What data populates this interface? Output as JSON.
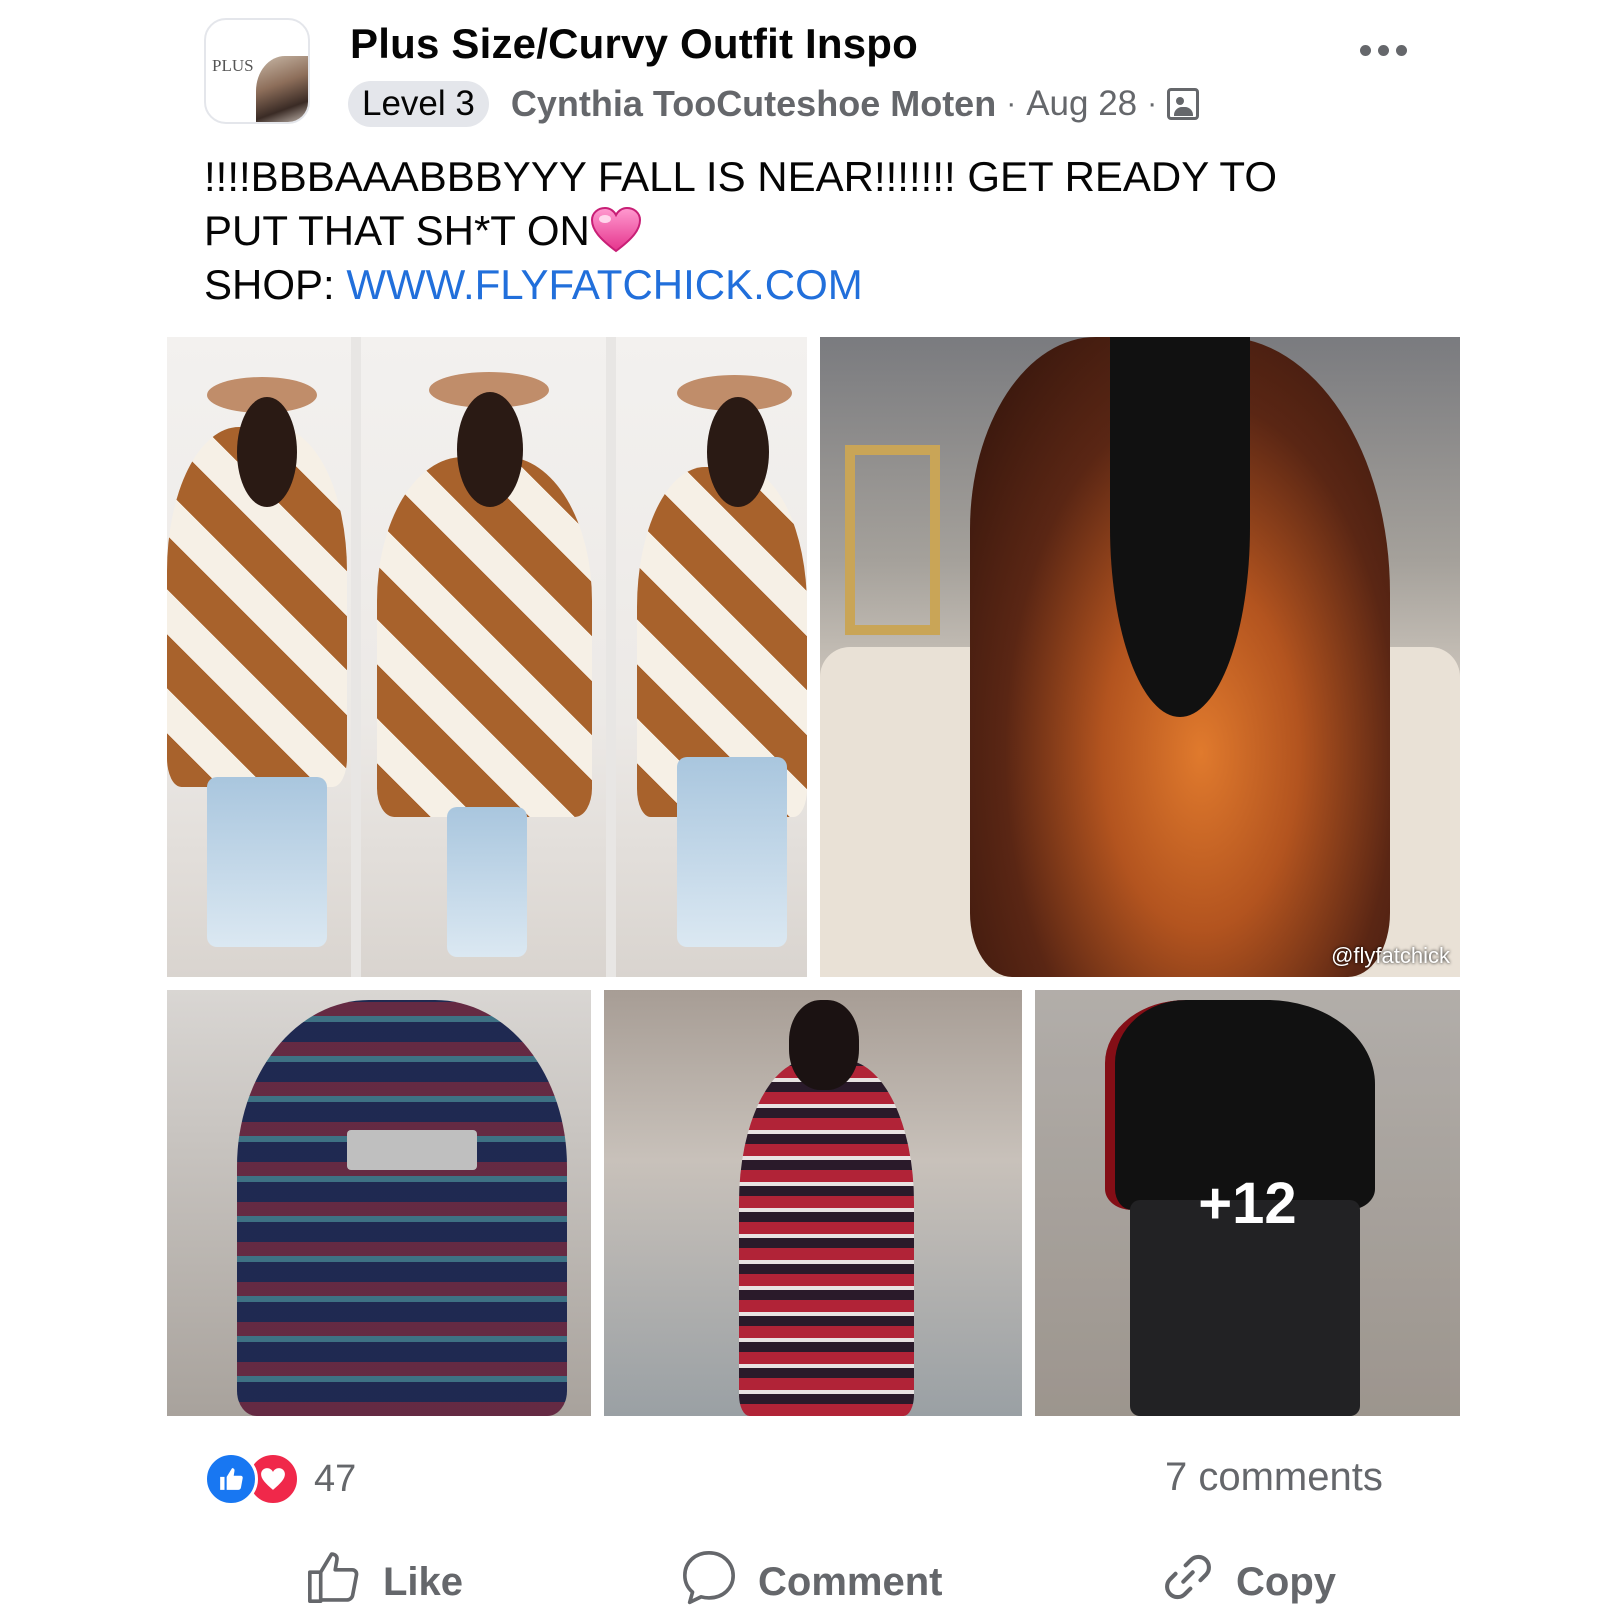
{
  "post": {
    "group_name": "Plus Size/Curvy Outfit Inspo",
    "avatar_text": "PLUS",
    "level_badge": "Level 3",
    "author": "Cynthia TooCuteshoe Moten",
    "date": "Aug 28",
    "separator": "·",
    "text_line_1": "!!!!BBBAAABBBYYY FALL IS NEAR!!!!!!! GET READY TO",
    "text_line_2": "PUT THAT SH*T ON",
    "shop_label": "SHOP: ",
    "shop_link": "WWW.FLYFATCHICK.COM",
    "icons": {
      "more": "more-options-icon",
      "privacy": "group-members-icon",
      "emoji": "pink-heart-emoji"
    }
  },
  "photos": {
    "watermark": "@flyfatchick",
    "more_count": "+12"
  },
  "stats": {
    "reaction_count": "47",
    "comments": "7 comments",
    "reaction_types": [
      "like",
      "love"
    ]
  },
  "actions": {
    "like": "Like",
    "comment": "Comment",
    "copy": "Copy"
  },
  "colors": {
    "link": "#216fdb",
    "secondary_text": "#65676b",
    "like_blue": "#1877f2",
    "love_red": "#f0284a"
  }
}
